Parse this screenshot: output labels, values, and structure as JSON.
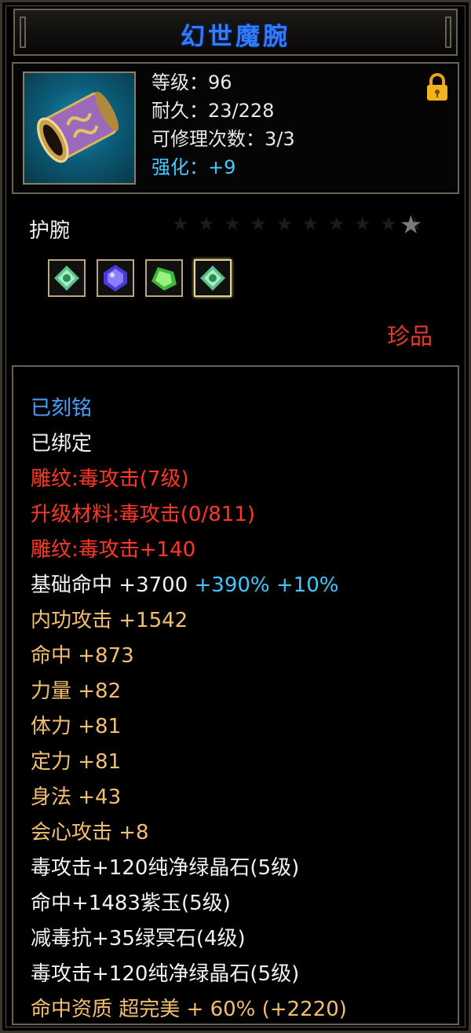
{
  "item": {
    "name": "幻世魔腕",
    "stats": {
      "level": "等级：96",
      "durability": "耐久：23/228",
      "repairs": "可修理次数：3/3",
      "enhance": "强化：+9"
    },
    "type": "护腕",
    "rarity": "珍品",
    "gems": [
      "green-crystal-gem",
      "purple-jade-gem",
      "green-stone-gem",
      "green-crystal-gem"
    ],
    "attributes": {
      "engraved": "已刻铭",
      "bound": "已绑定",
      "carving": "雕纹:毒攻击(7级)",
      "upgrade_material": "升级材料:毒攻击(0/811)",
      "carving_bonus": "雕纹:毒攻击+140",
      "base_hit_label": "基础命中",
      "base_hit_value": "+3700",
      "base_hit_pct1": "+390%",
      "base_hit_pct2": "+10%",
      "inner_attack": "内功攻击  +1542",
      "hit": "命中  +873",
      "strength": "力量  +82",
      "stamina": "体力  +81",
      "focus": "定力  +81",
      "agility": "身法  +43",
      "crit_attack": "会心攻击  +8",
      "gem1": "毒攻击+120纯净绿晶石(5级)",
      "gem2": "命中+1483紫玉(5级)",
      "gem3": "减毒抗+35绿冥石(4级)",
      "gem4": "毒攻击+120纯净绿晶石(5级)",
      "quality": "命中资质  超完美  + 60% (+2220)"
    }
  },
  "colors": {
    "title": "#2f7cff",
    "rarity": "#e23a2a",
    "carving": "#ff3828",
    "attribute": "#f0c070",
    "bonus": "#46c6ff",
    "engraved": "#4aa0ff"
  }
}
